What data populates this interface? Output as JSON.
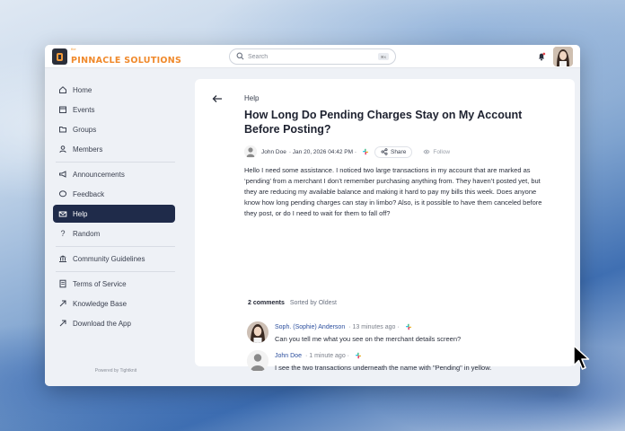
{
  "app": {
    "logo_small": "the",
    "logo_text": "PINNACLE SOLUTIONS",
    "brand_color": "#f0892b"
  },
  "search": {
    "placeholder": "Search",
    "shortcut": "⌘K"
  },
  "sidebar": {
    "items": [
      {
        "label": "Home",
        "icon": "home-icon"
      },
      {
        "label": "Events",
        "icon": "calendar-icon"
      },
      {
        "label": "Groups",
        "icon": "folder-icon"
      },
      {
        "label": "Members",
        "icon": "person-icon"
      },
      {
        "label": "Announcements",
        "icon": "megaphone-icon"
      },
      {
        "label": "Feedback",
        "icon": "chat-icon"
      },
      {
        "label": "Help",
        "icon": "help-icon",
        "active": true
      },
      {
        "label": "Random",
        "icon": "question-icon"
      },
      {
        "label": "Community Guidelines",
        "icon": "bank-icon"
      },
      {
        "label": "Terms of Service",
        "icon": "document-icon"
      },
      {
        "label": "Knowledge Base",
        "icon": "external-link-icon"
      },
      {
        "label": "Download the App",
        "icon": "external-link-icon"
      }
    ],
    "powered_by": "Powered by Tightknit",
    "active_color": "#1f2b4a"
  },
  "post": {
    "category": "Help",
    "title": "How Long Do Pending Charges Stay on My Account Before Posting?",
    "author": "John Doe",
    "date": "· Jan 20, 2026 04:42 PM ·",
    "share_label": "Share",
    "follow_label": "Follow",
    "body": "Hello I need some assistance. I noticed two large transactions in my account that are marked as ‘pending’ from a merchant I don’t remember purchasing anything from. They haven’t posted yet, but they are reducing my available balance and making it hard to pay my bills this week. Does anyone know how long pending charges can stay in limbo? Also, is it possible to have them canceled before they post, or do I need to wait for them to fall off?"
  },
  "comments": {
    "count_label": "2 comments",
    "sort_label": "Sorted by Oldest",
    "items": [
      {
        "author": "Soph. (Sophie) Anderson",
        "time": "· 13 minutes ago ·",
        "text": "Can you tell me what you see on the merchant details screen?"
      },
      {
        "author": "John Doe",
        "time": "· 1 minute ago ·",
        "text": "I see the two transactions underneath the name with \"Pending\" in yellow."
      }
    ],
    "name_color": "#2c4f9e"
  }
}
